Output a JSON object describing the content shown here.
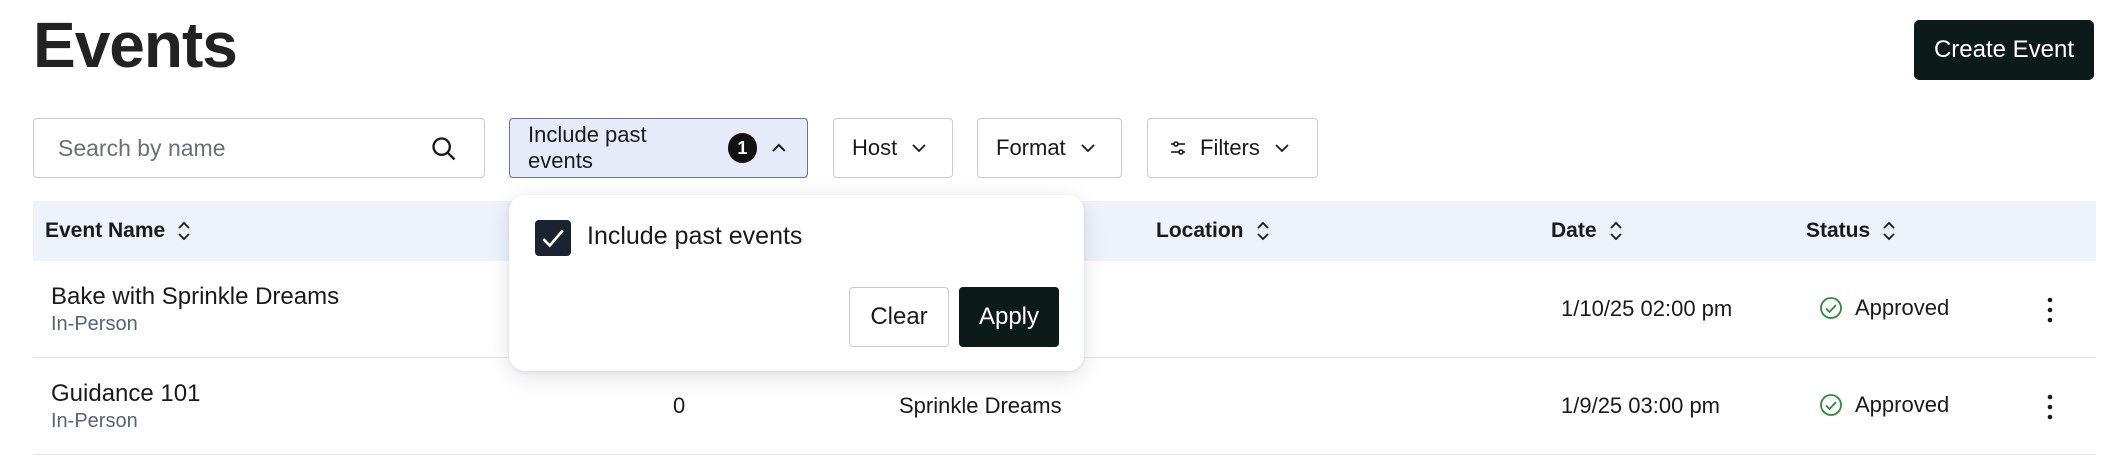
{
  "header": {
    "title": "Events",
    "create_label": "Create Event"
  },
  "search": {
    "placeholder": "Search by name",
    "value": "",
    "icon": "search-icon"
  },
  "filters": {
    "include_past": {
      "label": "Include past events",
      "count": "1",
      "icon": "chevron-up-icon"
    },
    "host": {
      "label": "Host",
      "icon": "chevron-down-icon"
    },
    "format": {
      "label": "Format",
      "icon": "chevron-down-icon"
    },
    "more": {
      "label": "Filters",
      "icon": "sliders-icon"
    }
  },
  "table": {
    "columns": [
      {
        "key": "name",
        "label": "Event Name"
      },
      {
        "key": "location",
        "label": "Location"
      },
      {
        "key": "date",
        "label": "Date"
      },
      {
        "key": "status",
        "label": "Status"
      }
    ],
    "rows": [
      {
        "name": "Bake with Sprinkle Dreams",
        "format": "In-Person",
        "count": "",
        "host": "",
        "date": "1/10/25 02:00 pm",
        "status": "Approved"
      },
      {
        "name": "Guidance 101",
        "format": "In-Person",
        "count": "0",
        "host": "Sprinkle Dreams",
        "date": "1/9/25 03:00 pm",
        "status": "Approved"
      }
    ]
  },
  "popover": {
    "checkbox_label": "Include past events",
    "checked": true,
    "clear_label": "Clear",
    "apply_label": "Apply"
  },
  "colors": {
    "primary": "#0c1a1a",
    "header_bg": "#eef2fb",
    "active_chip_bg": "#e7eaf8",
    "approved": "#2e8b3a",
    "muted_text": "#5b6278"
  }
}
